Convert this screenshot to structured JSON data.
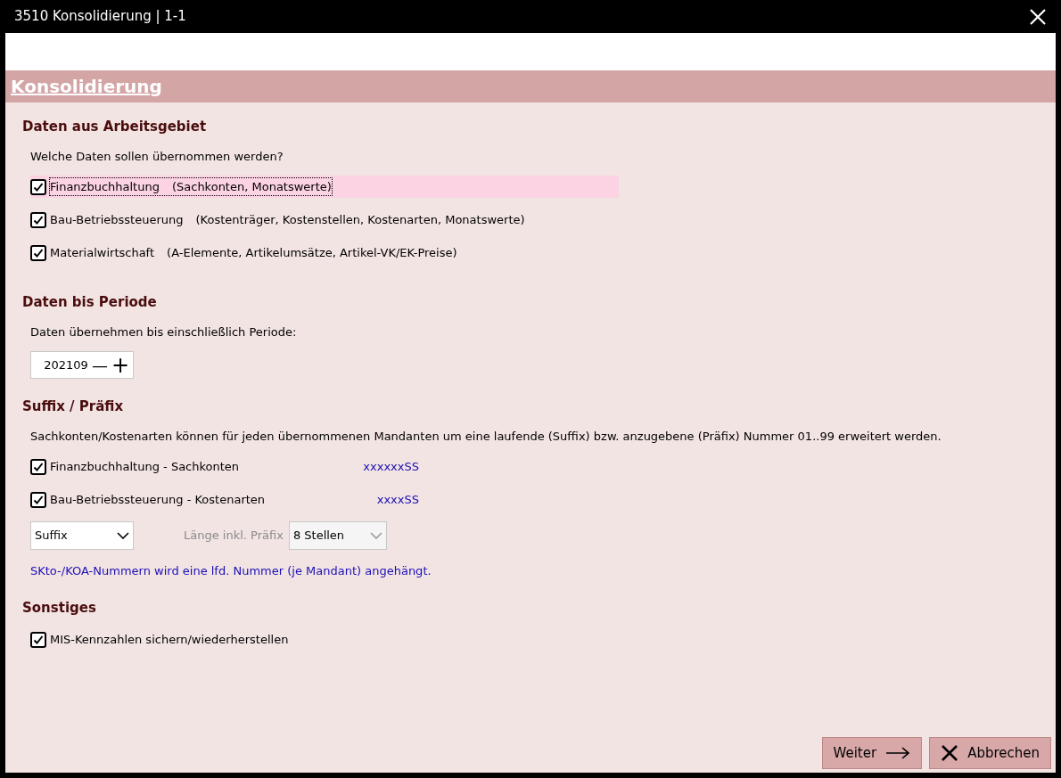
{
  "window": {
    "title": "3510 Konsolidierung | 1-1"
  },
  "header": {
    "title": "Konsolidierung"
  },
  "sections": [
    {
      "kind": "checks",
      "title": "Daten aus Arbeitsgebiet",
      "intro": "Welche Daten sollen übernommen werden?",
      "items": [
        {
          "label": "Finanzbuchhaltung",
          "detail": "(Sachkonten, Monatswerte)",
          "checked": true,
          "focused": true
        },
        {
          "label": "Bau-Betriebssteuerung",
          "detail": "(Kostenträger, Kostenstellen, Kostenarten, Monatswerte)",
          "checked": true,
          "focused": false
        },
        {
          "label": "Materialwirtschaft",
          "detail": "(A-Elemente, Artikelumsätze, Artikel-VK/EK-Preise)",
          "checked": true,
          "focused": false
        }
      ]
    },
    {
      "kind": "period",
      "title": "Daten bis Periode",
      "intro": "Daten übernehmen bis einschließlich Periode:",
      "value": "202109",
      "minus": "—",
      "plus": "+"
    },
    {
      "kind": "suffix",
      "title": "Suffix / Präfix",
      "intro": "Sachkonten/Kostenarten können für jeden übernommenen Mandanten um eine laufende (Suffix) bzw.  anzugebene (Präfix) Nummer 01..99 erweitert werden.",
      "items": [
        {
          "label": "Finanzbuchhaltung - Sachkonten",
          "pattern": "xxxxxxSS",
          "checked": true
        },
        {
          "label": "Bau-Betriebssteuerung - Kostenarten",
          "pattern": "xxxxSS",
          "checked": true
        }
      ],
      "mode": "Suffix",
      "length_label": "Länge inkl. Präfix",
      "length": "8 Stellen",
      "length_disabled": true,
      "note": "SKto-/KOA-Nummern wird eine lfd. Nummer (je Mandant) angehängt."
    },
    {
      "kind": "checks",
      "title": "Sonstiges",
      "items": [
        {
          "label": "MIS-Kennzahlen sichern/wiederherstellen",
          "checked": true,
          "focused": false
        }
      ]
    }
  ],
  "buttons": [
    {
      "kind": "next",
      "label": "Weiter"
    },
    {
      "kind": "cancel",
      "label": "Abbrechen"
    }
  ]
}
